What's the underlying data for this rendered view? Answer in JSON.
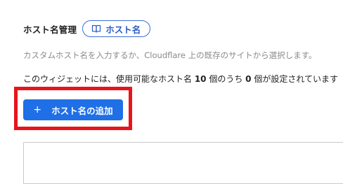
{
  "section": {
    "title": "ホスト名管理",
    "doc_link_label": "ホスト名"
  },
  "description": "カスタムホスト名を入力するか、Cloudflare 上の既存のサイトから選択します。",
  "usage": {
    "prefix": "このウィジェットには、使用可能なホスト名 ",
    "max": "10",
    "middle1": " 個のうち ",
    "used": "0",
    "suffix": " 個が設定されています"
  },
  "add_button": {
    "icon": "+",
    "label": "ホスト名の追加"
  },
  "colors": {
    "primary": "#1f6fe6",
    "link": "#2a5bc7",
    "highlight": "#e8141d"
  },
  "icons": {
    "doc_link": "book-icon",
    "add": "plus-icon"
  }
}
